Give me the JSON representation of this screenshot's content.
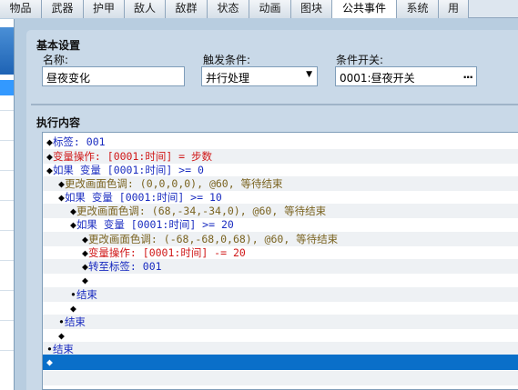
{
  "tabs": [
    "物品",
    "武器",
    "护甲",
    "敌人",
    "敌群",
    "状态",
    "动画",
    "图块",
    "公共事件",
    "系统",
    "用"
  ],
  "active_tab": "公共事件",
  "basic": {
    "group_title": "基本设置",
    "name_label": "名称:",
    "name_value": "昼夜变化",
    "trigger_label": "触发条件:",
    "trigger_value": "并行处理",
    "switch_label": "条件开关:",
    "switch_value": "0001:昼夜开关",
    "switch_button": "..."
  },
  "exec": {
    "group_title": "执行内容"
  },
  "lines": [
    {
      "marker": "◆",
      "text": "标签: 001",
      "color": "blue"
    },
    {
      "marker": "◆",
      "text": "变量操作: [0001:时间] = 步数",
      "color": "red"
    },
    {
      "marker": "◆",
      "text": "如果 变量 [0001:时间] >= 0",
      "color": "blue"
    },
    {
      "marker": "◆",
      "text": "更改画面色调: (0,0,0,0), @60, 等待结束",
      "color": "olive"
    },
    {
      "marker": "◆",
      "text": "如果 变量 [0001:时间] >= 10",
      "color": "blue"
    },
    {
      "marker": "◆",
      "text": "更改画面色调: (68,-34,-34,0), @60, 等待结束",
      "color": "olive"
    },
    {
      "marker": "◆",
      "text": "如果 变量 [0001:时间] >= 20",
      "color": "blue"
    },
    {
      "marker": "◆",
      "text": "更改画面色调: (-68,-68,0,68), @60, 等待结束",
      "color": "olive"
    },
    {
      "marker": "◆",
      "text": "变量操作: [0001:时间] -= 20",
      "color": "red"
    },
    {
      "marker": "◆",
      "text": "转至标签: 001",
      "color": "blue"
    },
    {
      "marker": "◆",
      "text": "",
      "color": "black"
    },
    {
      "marker": "•",
      "text": "结束",
      "color": "blue"
    },
    {
      "marker": "◆",
      "text": "",
      "color": "black"
    },
    {
      "marker": "•",
      "text": "结束",
      "color": "blue"
    },
    {
      "marker": "◆",
      "text": "",
      "color": "black"
    },
    {
      "marker": "•",
      "text": "结束",
      "color": "blue"
    },
    {
      "marker": "◆",
      "text": "",
      "color": "black"
    }
  ],
  "colors": {
    "accent": "#0a6fc9",
    "panel": "#c9d9e8",
    "blue_text": "#1a2cc0",
    "red_text": "#d01818",
    "olive_text": "#7a6320"
  }
}
